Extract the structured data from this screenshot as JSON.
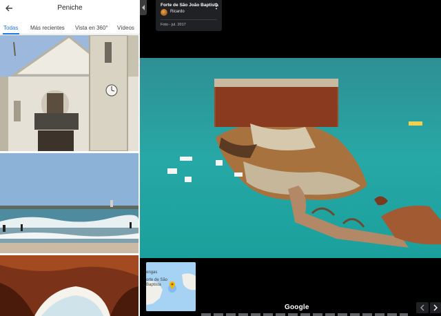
{
  "panel": {
    "title": "Peniche",
    "tabs": [
      {
        "label": "Todas"
      },
      {
        "label": "Más recientes"
      },
      {
        "label": "Vista en 360°"
      },
      {
        "label": "Vídeos"
      }
    ]
  },
  "photo_info": {
    "title": "Forte de São João Baptista",
    "author": "Ricardo",
    "date": "Foto - jul. 2017"
  },
  "minimap": {
    "label_top": "engas",
    "label_place": "orte de São\nBaptista"
  },
  "brand": "Google",
  "colors": {
    "accent": "#1a73e8",
    "card_bg": "#202124",
    "water": "#2aa7a4"
  },
  "icons": [
    "back-arrow-icon",
    "collapse-chevron-icon",
    "more-vert-icon",
    "location-pin-icon",
    "chevron-left-icon",
    "chevron-right-icon"
  ]
}
